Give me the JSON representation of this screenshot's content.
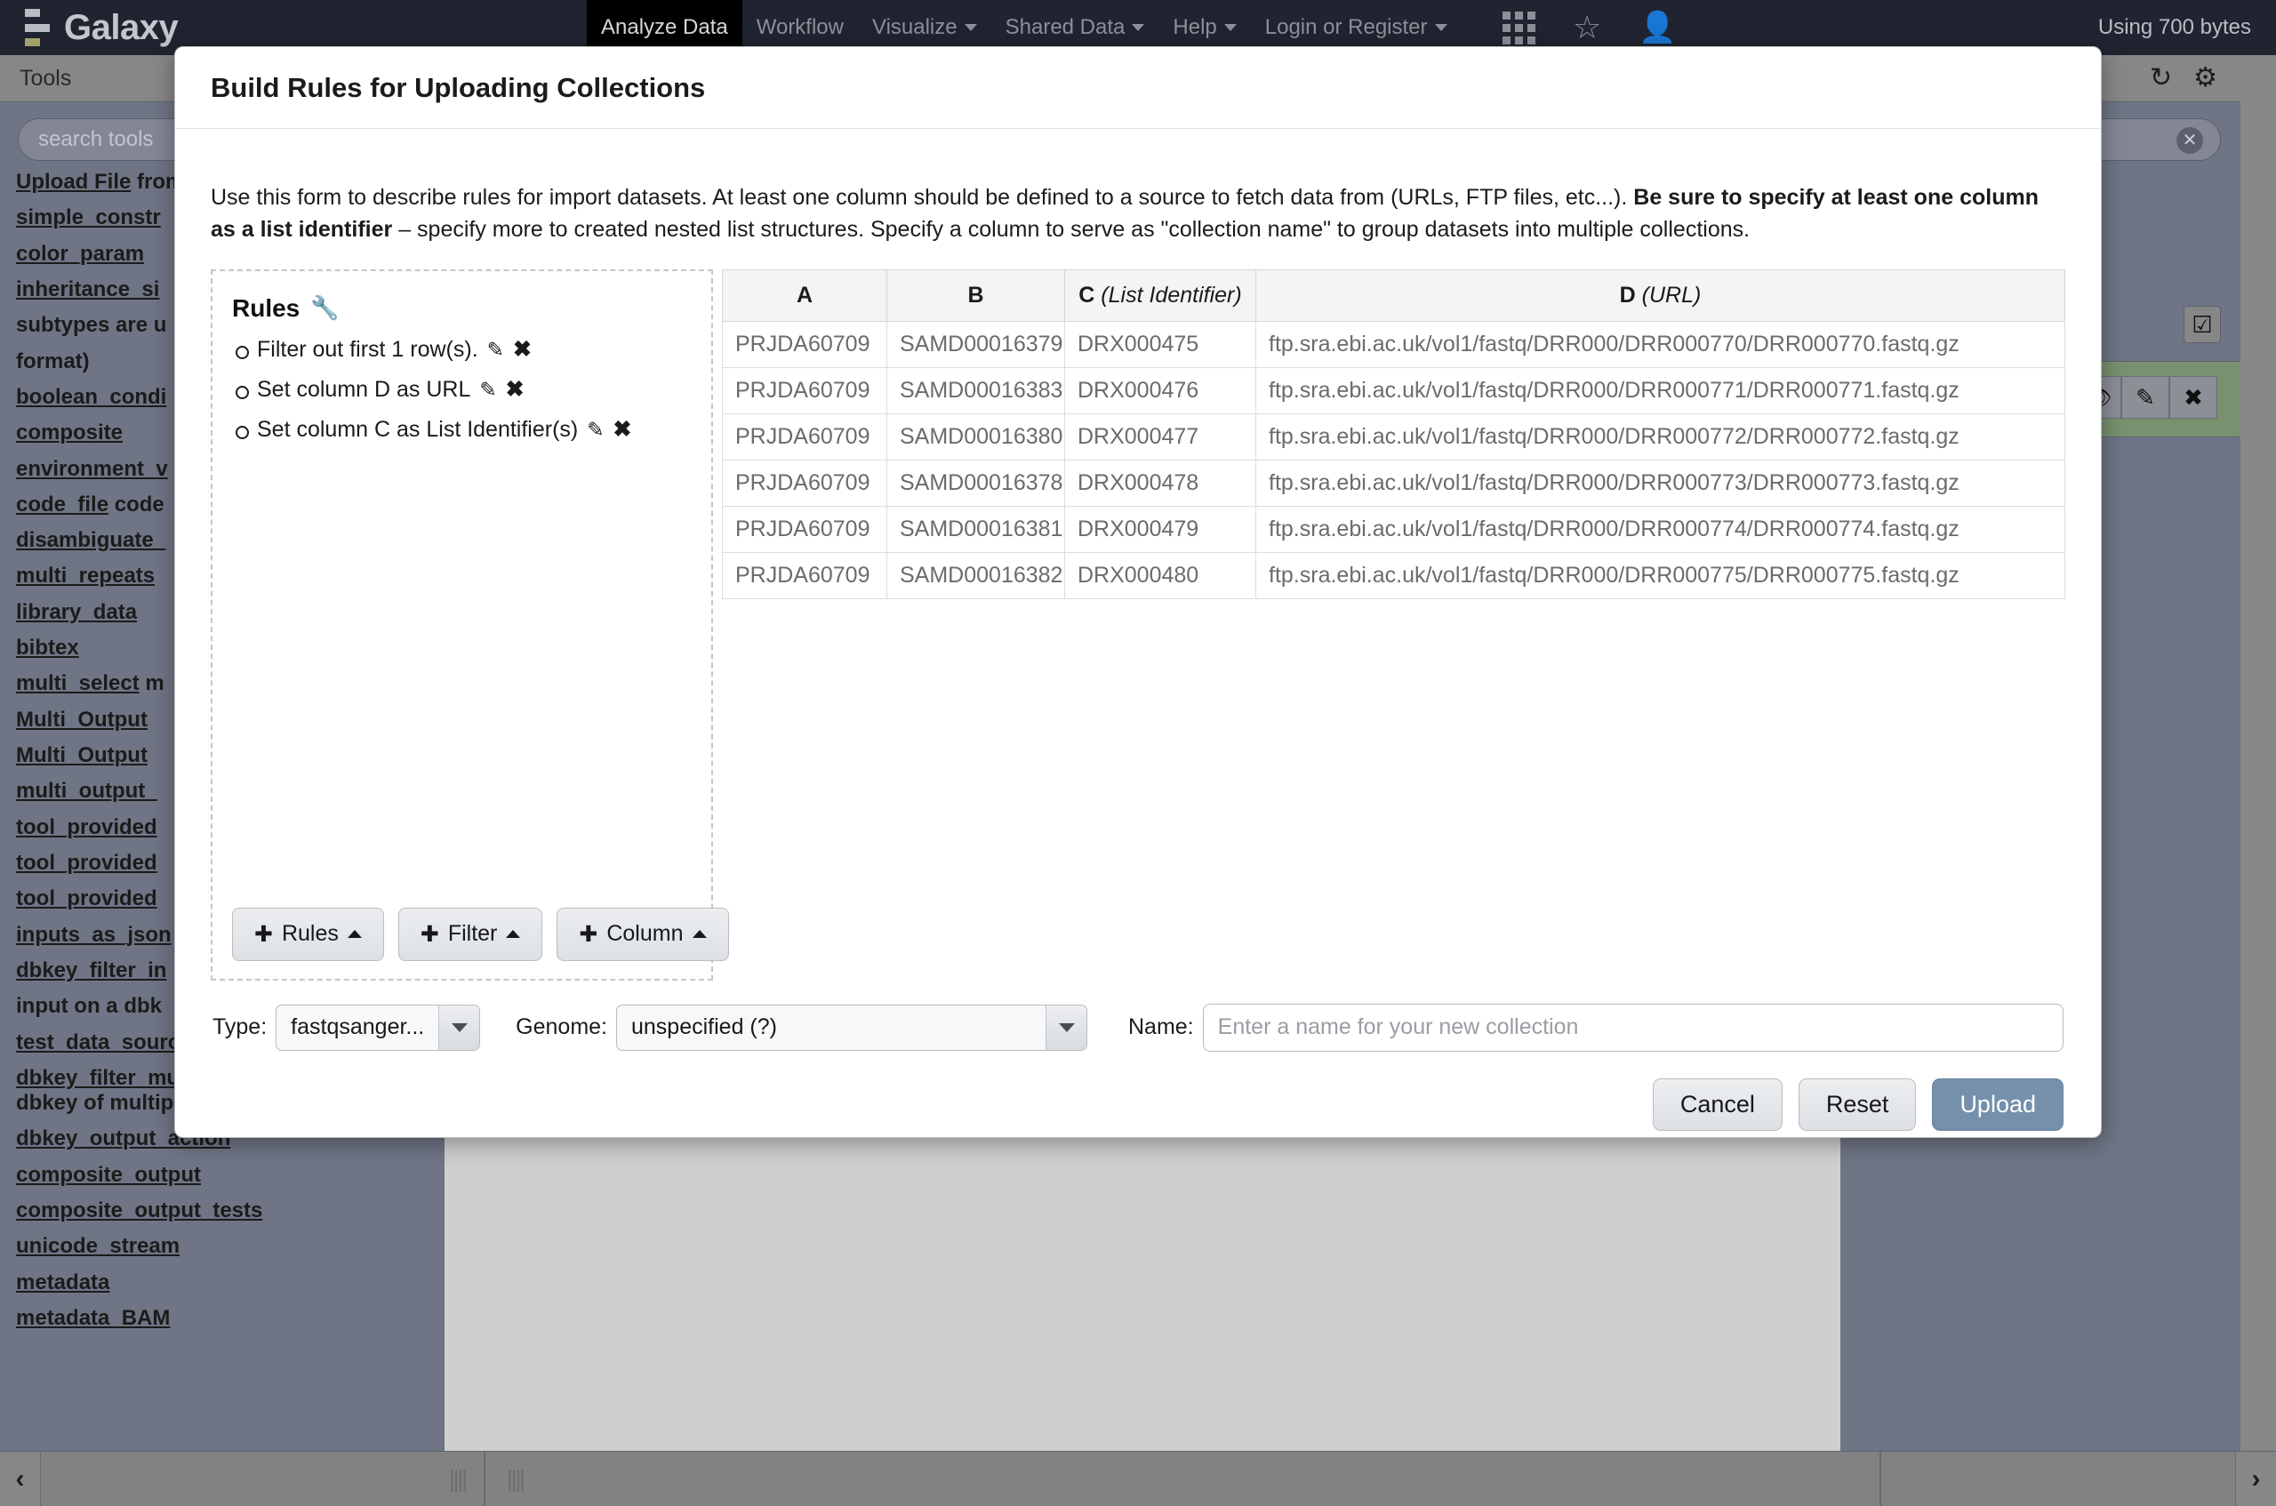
{
  "masthead": {
    "brand": "Galaxy",
    "nav": [
      {
        "label": "Analyze Data",
        "active": true,
        "caret": false
      },
      {
        "label": "Workflow",
        "active": false,
        "caret": false
      },
      {
        "label": "Visualize",
        "active": false,
        "caret": true
      },
      {
        "label": "Shared Data",
        "active": false,
        "caret": true
      },
      {
        "label": "Help",
        "active": false,
        "caret": true
      },
      {
        "label": "Login or Register",
        "active": false,
        "caret": true
      }
    ],
    "icons": [
      "grid-icon",
      "star-icon",
      "user-icon"
    ],
    "usage": "Using 700 bytes"
  },
  "tool_panel": {
    "title": "Tools",
    "search_placeholder": "search tools",
    "items": [
      {
        "link": "Upload File",
        "rest": " from",
        "wrap": false
      },
      {
        "link": "simple_constr",
        "rest": "",
        "wrap": false
      },
      {
        "link": "color_param",
        "rest": "",
        "wrap": false
      },
      {
        "link": "inheritance_si",
        "rest": "",
        "wrap": false
      },
      {
        "link": "",
        "rest": "subtypes are u",
        "wrap": false
      },
      {
        "link": "",
        "rest": "format)",
        "wrap": false
      },
      {
        "link": "boolean_condi",
        "rest": "",
        "wrap": false
      },
      {
        "link": "composite",
        "rest": "",
        "wrap": false
      },
      {
        "link": "environment_v",
        "rest": "",
        "wrap": false
      },
      {
        "link": "code_file",
        "rest": " code",
        "wrap": false
      },
      {
        "link": "disambiguate_",
        "rest": "",
        "wrap": false
      },
      {
        "link": "multi_repeats",
        "rest": "",
        "wrap": false
      },
      {
        "link": "library_data",
        "rest": "",
        "wrap": false
      },
      {
        "link": "bibtex",
        "rest": "",
        "wrap": false
      },
      {
        "link": "multi_select",
        "rest": " m",
        "wrap": false
      },
      {
        "link": "Multi_Output",
        "rest": "",
        "wrap": false
      },
      {
        "link": "Multi_Output",
        "rest": "",
        "wrap": false
      },
      {
        "link": "multi_output_",
        "rest": "",
        "wrap": false
      },
      {
        "link": "tool_provided",
        "rest": "",
        "wrap": false
      },
      {
        "link": "tool_provided",
        "rest": "",
        "wrap": false
      },
      {
        "link": "tool_provided",
        "rest": "",
        "wrap": false
      },
      {
        "link": "inputs_as_json",
        "rest": "",
        "wrap": false
      },
      {
        "link": "dbkey_filter_in",
        "rest": "",
        "wrap": false
      },
      {
        "link": "",
        "rest": "input on a dbk",
        "wrap": false
      },
      {
        "link": "test_data_source",
        "rest": "",
        "wrap": false
      },
      {
        "link": "dbkey_filter_multi_input",
        "rest": " Filter select on dbkey of multiple inputs",
        "wrap": true
      },
      {
        "link": "dbkey_output_action",
        "rest": "",
        "wrap": false
      },
      {
        "link": "composite_output",
        "rest": "",
        "wrap": false
      },
      {
        "link": "composite_output_tests",
        "rest": "",
        "wrap": false
      },
      {
        "link": "unicode_stream",
        "rest": "",
        "wrap": false
      },
      {
        "link": "metadata",
        "rest": "",
        "wrap": false
      },
      {
        "link": "metadata_BAM",
        "rest": "",
        "wrap": false
      }
    ]
  },
  "history_panel": {
    "refresh_icon": "↻",
    "gear_icon": "⚙",
    "clear_icon": "✕",
    "select_icon": "☑",
    "item_actions": [
      "👁",
      "✎",
      "✖"
    ]
  },
  "bottom_bar": {
    "left_collapse": "‹",
    "right_collapse": "›",
    "grip": "||||"
  },
  "modal": {
    "title": "Build Rules for Uploading Collections",
    "intro": {
      "part1": "Use this form to describe rules for import datasets. At least one column should be defined to a source to fetch data from (URLs, FTP files, etc...). ",
      "bold1": "Be sure to specify at least one column as a list identifier",
      "part2": " – specify more to created nested list structures. Specify a column to serve as \"collection name\" to group datasets into multiple collections."
    },
    "rules": {
      "title": "Rules",
      "wrench_icon": "🔧",
      "edit_icon": "✎",
      "delete_icon": "✖",
      "items": [
        "Filter out first 1 row(s).",
        "Set column D as URL",
        "Set column C as List Identifier(s)"
      ]
    },
    "rule_buttons": [
      {
        "label": "Rules",
        "plus": "✚"
      },
      {
        "label": "Filter",
        "plus": "✚"
      },
      {
        "label": "Column",
        "plus": "✚"
      }
    ],
    "table": {
      "headers": [
        {
          "letter": "A",
          "note": ""
        },
        {
          "letter": "B",
          "note": ""
        },
        {
          "letter": "C",
          "note": "(List Identifier)"
        },
        {
          "letter": "D",
          "note": "(URL)"
        }
      ],
      "rows": [
        [
          "PRJDA60709",
          "SAMD00016379",
          "DRX000475",
          "ftp.sra.ebi.ac.uk/vol1/fastq/DRR000/DRR000770/DRR000770.fastq.gz"
        ],
        [
          "PRJDA60709",
          "SAMD00016383",
          "DRX000476",
          "ftp.sra.ebi.ac.uk/vol1/fastq/DRR000/DRR000771/DRR000771.fastq.gz"
        ],
        [
          "PRJDA60709",
          "SAMD00016380",
          "DRX000477",
          "ftp.sra.ebi.ac.uk/vol1/fastq/DRR000/DRR000772/DRR000772.fastq.gz"
        ],
        [
          "PRJDA60709",
          "SAMD00016378",
          "DRX000478",
          "ftp.sra.ebi.ac.uk/vol1/fastq/DRR000/DRR000773/DRR000773.fastq.gz"
        ],
        [
          "PRJDA60709",
          "SAMD00016381",
          "DRX000479",
          "ftp.sra.ebi.ac.uk/vol1/fastq/DRR000/DRR000774/DRR000774.fastq.gz"
        ],
        [
          "PRJDA60709",
          "SAMD00016382",
          "DRX000480",
          "ftp.sra.ebi.ac.uk/vol1/fastq/DRR000/DRR000775/DRR000775.fastq.gz"
        ]
      ]
    },
    "form": {
      "type_label": "Type:",
      "type_value": "fastqsanger...",
      "genome_label": "Genome:",
      "genome_value": "unspecified (?)",
      "name_label": "Name:",
      "name_value": "",
      "name_placeholder": "Enter a name for your new collection"
    },
    "actions": {
      "cancel": "Cancel",
      "reset": "Reset",
      "upload": "Upload",
      "upload_color": "#7490ab"
    }
  }
}
